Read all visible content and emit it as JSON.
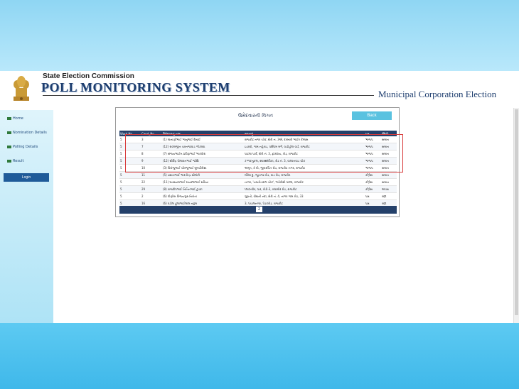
{
  "header": {
    "org_name": "State Election Commission",
    "system_title": "POLL MONITORING SYSTEM",
    "election_type": "Municipal Corporation Election"
  },
  "sidebar": {
    "items": [
      {
        "label": "Home",
        "icon": "grid-icon"
      },
      {
        "label": "Nomination Details",
        "icon": "grid-icon"
      },
      {
        "label": "Polling Details",
        "icon": "grid-icon"
      },
      {
        "label": "Result",
        "icon": "grid-icon"
      }
    ],
    "login_label": "Login"
  },
  "panel": {
    "title": "ઉમેદવારની વિગત",
    "back_label": "Back"
  },
  "table": {
    "headers": [
      "Ward No",
      "Cand_No",
      "ઉમેદવારનું નામ",
      "સરનામું",
      "પક્ષ",
      "સ્થિતિ"
    ],
    "rows": [
      [
        "5",
        "3",
        "(1) ઘાનાણીભાઈ ભાનુભાઈ દેસાઈ",
        "રાજકોટ નગર ચોક, શેરી નં. 3એ, દરબારી ભાઈર કેમ્પસ",
        "ભાજપ",
        "સમાન"
      ],
      [
        "5",
        "7",
        "(12) રાવલજીત ચરનજાવાડ ગોંડલવા",
        "ઇડરવો, ગામ નહેરાડ, પશ્ચિમ મર્ગ, વાડીહોલ વાર્ડ, રાજકોટ",
        "ભાજપ",
        "સમાન"
      ],
      [
        "5",
        "8",
        "(7) સંજયભાઈન પ્રવિણભાઈ ભાકવોરા",
        "પાટલા પાર્ક, શેરી નં. 3, ફ્રાંકદાય, રોડ, રાજકોટ",
        "ભાજપ",
        "સમાન"
      ],
      [
        "5",
        "9",
        "(12) સોરિંદ્ર પોલાવનભાઈ જોશિ",
        "ઝળકનુકલ, સ્વાસ્થ્મંવિકા, રોડ નં. 3, વાલ્વનવાડ ચોક",
        "ભાજપ",
        "સમાન"
      ],
      [
        "5",
        "10",
        "(3) વિરાંજુભાઈ ચીરજુભાઈ ઘૂમર્ચારીસા",
        "અમૃત, 4 વી, જીવરચિત રોડ, રાજકોટ નગર, રાજકોટ",
        "ભાજપ",
        "સમાન"
      ],
      [
        "5",
        "11",
        "(5) ઇશાનભાઈ ભારતીન્દ્ર સોલંકી",
        "મોરેરા દુ, જૂનાગઢ રોડ, વાડ રોડ, રાજકોટ",
        "કોંગ્રેસ",
        "સમાન"
      ],
      [
        "5",
        "22",
        "(11) ઘનશ્યામભાઈ રાયસ્ભાભાઈ સરિયા",
        "નાગર, 'નવનીતાપ્રભ ચોક', ભાડેરીથી પાલ્લ, રાજકોટ",
        "કોંગ્રેસ",
        "સમાન"
      ],
      [
        "5",
        "29",
        "(8) રાજદીપભાઈ નિતિનભાઈ ટુડકા",
        "પ્લાઝ્વીર, પાર, રોડી-3, રાધામીર રોડ, રાજકોટ",
        "કોંગ્રેસ",
        "અપક્ષ"
      ],
      [
        "5",
        "2",
        "(6) વીણીબ વિજયગુરુ નિરાંતા",
        "ગુણતો, વોશની નંદા, શેરી નં. 4, નાગર ગામ રોડ, 33",
        "પક્ષ",
        "રદ્દ"
      ],
      [
        "5",
        "16",
        "(6) વડીલ ફુલાભાઈલાલ નકુમ",
        "3, પંચાલનગર, પેડકરોડ, રાજકોટ",
        "પક્ષ",
        "રદ્દ"
      ]
    ]
  },
  "pager": {
    "current": "2"
  },
  "colors": {
    "header_navy": "#24406a",
    "accent": "#5ac2e0",
    "highlight": "#d73a3a"
  }
}
